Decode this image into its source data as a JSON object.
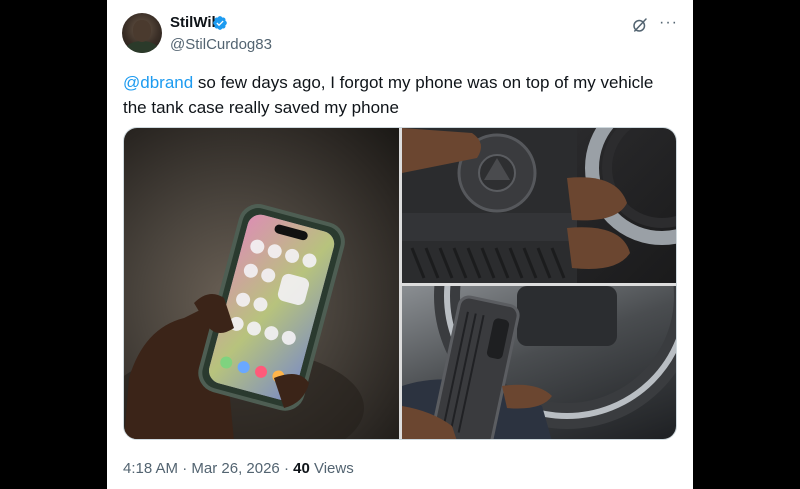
{
  "author": {
    "display_name": "StilWil",
    "handle": "@StilCurdog83",
    "verified": true
  },
  "tweet": {
    "mention": "@dbrand",
    "text_line1_rest": " so few days ago, I forgot my phone was on top of my vehicle",
    "text_line2": "the tank case really saved my phone"
  },
  "meta": {
    "time": "4:18 AM",
    "separator1": " · ",
    "date": "Mar 26, 2026",
    "separator2": " · ",
    "views_count": "40",
    "views_label": " Views"
  },
  "icons": {
    "verified": "verified-badge-icon",
    "grok": "grok-icon",
    "more": "more-icon"
  },
  "colors": {
    "accent": "#1d9bf0",
    "text_primary": "#0f1419",
    "text_secondary": "#536471",
    "verified_blue": "#1d9bf0"
  }
}
